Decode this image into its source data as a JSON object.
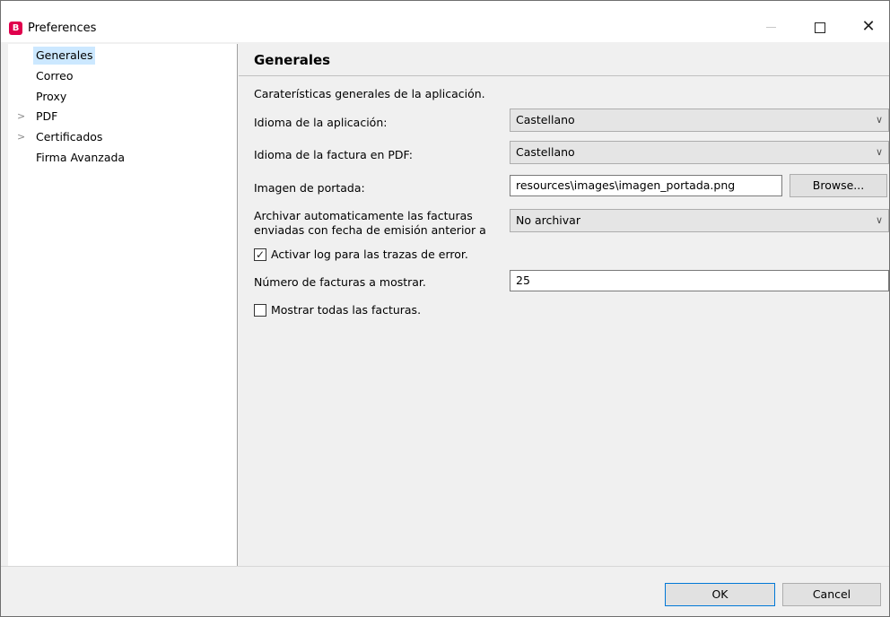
{
  "window": {
    "title": "Preferences",
    "app_icon_glyph": "B",
    "accent_color": "#e0004d"
  },
  "nav": {
    "items": [
      {
        "label": "Generales",
        "selected": true,
        "expandable": false
      },
      {
        "label": "Correo",
        "selected": false,
        "expandable": false
      },
      {
        "label": "Proxy",
        "selected": false,
        "expandable": false
      },
      {
        "label": "PDF",
        "selected": false,
        "expandable": true
      },
      {
        "label": "Certificados",
        "selected": false,
        "expandable": true
      },
      {
        "label": "Firma Avanzada",
        "selected": false,
        "expandable": false
      }
    ]
  },
  "page": {
    "title": "Generales",
    "description": "Caraterísticas generales de la aplicación.",
    "fields": {
      "app_language": {
        "label": "Idioma de la aplicación:",
        "value": "Castellano"
      },
      "pdf_language": {
        "label": "Idioma de la factura en PDF:",
        "value": "Castellano"
      },
      "cover_image": {
        "label": "Imagen de portada:",
        "value": "resources\\images\\imagen_portada.png",
        "browse_label": "Browse..."
      },
      "archive": {
        "label_line1": "Archivar automaticamente las facturas",
        "label_line2": "enviadas con fecha de emisión anterior a",
        "value": "No archivar"
      },
      "error_log": {
        "label": "Activar log para las trazas de error.",
        "checked": true
      },
      "invoice_count": {
        "label": "Número de facturas a mostrar.",
        "value": "25"
      },
      "show_all": {
        "label": "Mostrar todas las facturas.",
        "checked": false
      }
    }
  },
  "footer": {
    "ok_label": "OK",
    "cancel_label": "Cancel"
  }
}
